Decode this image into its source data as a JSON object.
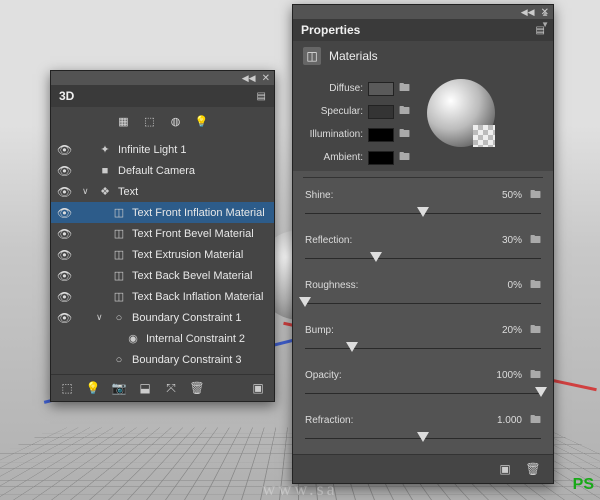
{
  "panel3d": {
    "title": "3D",
    "toolbar_icons": [
      "scene-filter-icon",
      "mesh-filter-icon",
      "material-filter-icon",
      "light-filter-icon"
    ],
    "items": [
      {
        "vis": "👁",
        "depth": 0,
        "twisty": "",
        "icon": "✦",
        "label": "Infinite Light 1",
        "sel": false,
        "kind": "light"
      },
      {
        "vis": "👁",
        "depth": 0,
        "twisty": "",
        "icon": "■",
        "label": "Default Camera",
        "sel": false,
        "kind": "camera"
      },
      {
        "vis": "👁",
        "depth": 0,
        "twisty": "∨",
        "icon": "❖",
        "label": "Text",
        "sel": false,
        "kind": "mesh"
      },
      {
        "vis": "👁",
        "depth": 1,
        "twisty": "",
        "icon": "◫",
        "label": "Text Front Inflation Material",
        "sel": true,
        "kind": "material"
      },
      {
        "vis": "👁",
        "depth": 1,
        "twisty": "",
        "icon": "◫",
        "label": "Text Front Bevel Material",
        "sel": false,
        "kind": "material"
      },
      {
        "vis": "👁",
        "depth": 1,
        "twisty": "",
        "icon": "◫",
        "label": "Text Extrusion Material",
        "sel": false,
        "kind": "material"
      },
      {
        "vis": "👁",
        "depth": 1,
        "twisty": "",
        "icon": "◫",
        "label": "Text Back Bevel Material",
        "sel": false,
        "kind": "material"
      },
      {
        "vis": "👁",
        "depth": 1,
        "twisty": "",
        "icon": "◫",
        "label": "Text Back Inflation Material",
        "sel": false,
        "kind": "material"
      },
      {
        "vis": "👁",
        "depth": 1,
        "twisty": "∨",
        "icon": "○",
        "label": "Boundary Constraint 1",
        "sel": false,
        "kind": "constraint"
      },
      {
        "vis": "",
        "depth": 2,
        "twisty": "",
        "icon": "◉",
        "label": "Internal Constraint 2",
        "sel": false,
        "kind": "constraint"
      },
      {
        "vis": "",
        "depth": 1,
        "twisty": "",
        "icon": "○",
        "label": "Boundary Constraint 3",
        "sel": false,
        "kind": "constraint"
      }
    ],
    "footer_icons_left": [
      "filter-icon",
      "light-bulb-icon",
      "camera-icon",
      "trash-icon",
      "ground-icon",
      "axis-icon"
    ],
    "footer_icons_right": [
      "render-icon"
    ]
  },
  "properties": {
    "title": "Properties",
    "section": "Materials",
    "colors": [
      {
        "label": "Diffuse:",
        "swatch": "#5a5a5a",
        "name": "diffuse"
      },
      {
        "label": "Specular:",
        "swatch": "#343434",
        "name": "specular"
      },
      {
        "label": "Illumination:",
        "swatch": "#000000",
        "name": "illumination"
      },
      {
        "label": "Ambient:",
        "swatch": "#000000",
        "name": "ambient"
      }
    ],
    "sliders": [
      {
        "label": "Shine:",
        "value": "50%",
        "pos": 50,
        "name": "shine"
      },
      {
        "label": "Reflection:",
        "value": "30%",
        "pos": 30,
        "name": "reflection"
      },
      {
        "label": "Roughness:",
        "value": "0%",
        "pos": 0,
        "name": "roughness"
      },
      {
        "label": "Bump:",
        "value": "20%",
        "pos": 20,
        "name": "bump"
      },
      {
        "label": "Opacity:",
        "value": "100%",
        "pos": 100,
        "name": "opacity"
      },
      {
        "label": "Refraction:",
        "value": "1.000",
        "pos": 50,
        "name": "refraction"
      }
    ]
  },
  "watermark_center": "www.sa",
  "watermark_corner": "PS"
}
